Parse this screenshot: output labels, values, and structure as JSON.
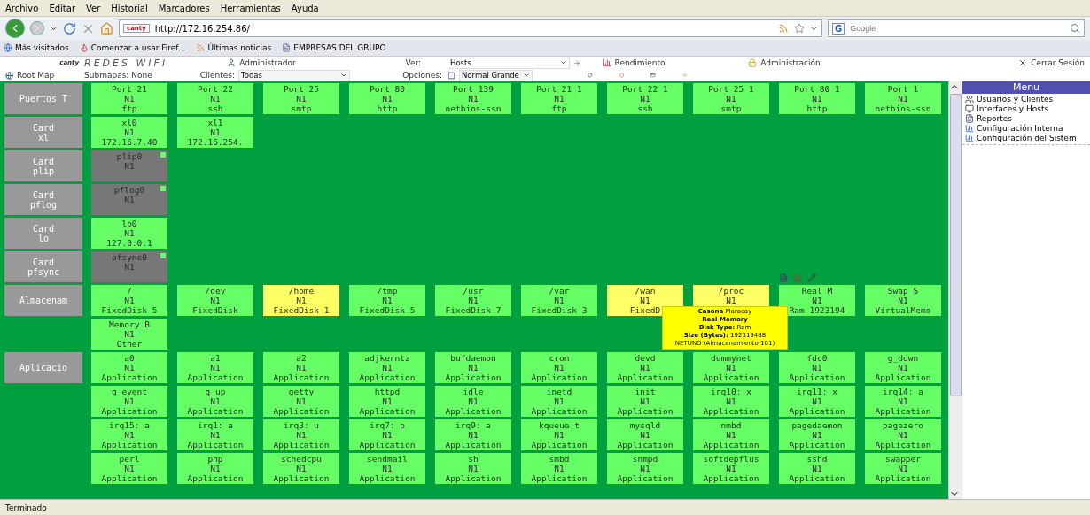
{
  "browser": {
    "menu": [
      "Archivo",
      "Editar",
      "Ver",
      "Historial",
      "Marcadores",
      "Herramientas",
      "Ayuda"
    ],
    "favicon": "canty",
    "url": "http://172.16.254.86/",
    "search": {
      "engine": "G",
      "placeholder": "Google"
    },
    "bookmarks": [
      "Más visitados",
      "Comenzar a usar Firef...",
      "Últimas noticias",
      "EMPRESAS DEL GRUPO"
    ]
  },
  "header": {
    "logo": "canty",
    "title": "REDES WIFI",
    "user": "Administrador",
    "ver_label": "Ver:",
    "ver_value": "Hosts",
    "rendimiento": "Rendimiento",
    "administracion": "Administración",
    "logout": "Cerrar Sesión",
    "root_map": "Root Map",
    "submapas": "Submapas: None",
    "clientes_label": "Clientes:",
    "clientes_value": "Todas",
    "opciones_label": "Opciones:",
    "opciones_value": "Normal Grande"
  },
  "groups": [
    {
      "label": [
        "Puertos T"
      ],
      "rows": [
        [
          {
            "lines": [
              "Port 21",
              "N1",
              "ftp"
            ],
            "color": "#66ff66",
            "indicator": false
          },
          {
            "lines": [
              "Port 22",
              "N1",
              "ssh"
            ],
            "color": "#66ff66",
            "indicator": false
          },
          {
            "lines": [
              "Port 25",
              "N1",
              "smtp"
            ],
            "color": "#66ff66",
            "indicator": false
          },
          {
            "lines": [
              "Port 80",
              "N1",
              "http"
            ],
            "color": "#66ff66",
            "indicator": false
          },
          {
            "lines": [
              "Port 139",
              "N1",
              "netbios-ssn"
            ],
            "color": "#66ff66",
            "indicator": false
          },
          {
            "lines": [
              "Port 21 1",
              "N1",
              "ftp"
            ],
            "color": "#66ff66",
            "indicator": false
          },
          {
            "lines": [
              "Port 22 1",
              "N1",
              "ssh"
            ],
            "color": "#66ff66",
            "indicator": false
          },
          {
            "lines": [
              "Port 25 1",
              "N1",
              "smtp"
            ],
            "color": "#66ff66",
            "indicator": false
          },
          {
            "lines": [
              "Port 80 1",
              "N1",
              "http"
            ],
            "color": "#66ff66",
            "indicator": false
          },
          {
            "lines": [
              "Port 1",
              "N1",
              "netbios-ssn"
            ],
            "color": "#66ff66",
            "indicator": false
          }
        ]
      ]
    },
    {
      "label": [
        "Card",
        "xl"
      ],
      "rows": [
        [
          {
            "lines": [
              "xl0",
              "N1",
              "172.16.7.40"
            ],
            "color": "#66ff66",
            "indicator": false
          },
          {
            "lines": [
              "xl1",
              "N1",
              "172.16.254."
            ],
            "color": "#66ff66",
            "indicator": false
          }
        ]
      ]
    },
    {
      "label": [
        "Card",
        "plip"
      ],
      "rows": [
        [
          {
            "lines": [
              "plip0",
              "N1"
            ],
            "color": "#777777",
            "indicator": true
          }
        ]
      ]
    },
    {
      "label": [
        "Card",
        "pflog"
      ],
      "rows": [
        [
          {
            "lines": [
              "pflog0",
              "N1"
            ],
            "color": "#777777",
            "indicator": true
          }
        ]
      ]
    },
    {
      "label": [
        "Card",
        "lo"
      ],
      "rows": [
        [
          {
            "lines": [
              "lo0",
              "N1",
              "127.0.0.1"
            ],
            "color": "#66ff66",
            "indicator": false
          }
        ]
      ]
    },
    {
      "label": [
        "Card",
        "pfsync"
      ],
      "rows": [
        [
          {
            "lines": [
              "pfsync0",
              "N1"
            ],
            "color": "#777777",
            "indicator": true
          }
        ]
      ]
    },
    {
      "label": [
        "Almacenam"
      ],
      "rows": [
        [
          {
            "lines": [
              "/",
              "N1",
              "FixedDisk 5"
            ],
            "color": "#66ff66",
            "indicator": false
          },
          {
            "lines": [
              "/dev",
              "N1",
              "FixedDisk"
            ],
            "color": "#66ff66",
            "indicator": false
          },
          {
            "lines": [
              "/home",
              "N1",
              "FixedDisk 1"
            ],
            "color": "#ffff66",
            "indicator": false
          },
          {
            "lines": [
              "/tmp",
              "N1",
              "FixedDisk 5"
            ],
            "color": "#66ff66",
            "indicator": false
          },
          {
            "lines": [
              "/usr",
              "N1",
              "FixedDisk 7"
            ],
            "color": "#66ff66",
            "indicator": false
          },
          {
            "lines": [
              "/var",
              "N1",
              "FixedDisk 3"
            ],
            "color": "#66ff66",
            "indicator": false
          },
          {
            "lines": [
              "/wan",
              "N1",
              "FixedD"
            ],
            "color": "#ffff66",
            "indicator": false,
            "tooltip": [
              "**Casona** Maracay",
              "**Real Memory**",
              "**Disk Type:** Ram",
              "**Size (Bytes):** 192319488",
              "NETUNO (Almacenamiento 101)"
            ]
          },
          {
            "lines": [
              "/proc",
              "N1"
            ],
            "color": "#ffff66",
            "indicator": false
          },
          {
            "lines": [
              "Real M",
              "N1",
              "Ram 1923194"
            ],
            "color": "#66ff66",
            "indicator": false,
            "actions": true
          },
          {
            "lines": [
              "Swap S",
              "N1",
              "VirtualMemo"
            ],
            "color": "#66ff66",
            "indicator": false
          }
        ],
        [
          {
            "lines": [
              "Memory B",
              "N1",
              "Other"
            ],
            "color": "#66ff66",
            "indicator": false
          }
        ]
      ]
    },
    {
      "label": [
        "Aplicacio"
      ],
      "rows": [
        [
          {
            "lines": [
              "a0",
              "N1",
              "Application"
            ],
            "color": "#66ff66",
            "indicator": false
          },
          {
            "lines": [
              "a1",
              "N1",
              "Application"
            ],
            "color": "#66ff66",
            "indicator": false
          },
          {
            "lines": [
              "a2",
              "N1",
              "Application"
            ],
            "color": "#66ff66",
            "indicator": false
          },
          {
            "lines": [
              "adjkerntz",
              "N1",
              "Application"
            ],
            "color": "#66ff66",
            "indicator": false
          },
          {
            "lines": [
              "bufdaemon",
              "N1",
              "Application"
            ],
            "color": "#66ff66",
            "indicator": false
          },
          {
            "lines": [
              "cron",
              "N1",
              "Application"
            ],
            "color": "#66ff66",
            "indicator": false
          },
          {
            "lines": [
              "devd",
              "N1",
              "Application"
            ],
            "color": "#66ff66",
            "indicator": false
          },
          {
            "lines": [
              "dummynet",
              "N1",
              "Application"
            ],
            "color": "#66ff66",
            "indicator": false
          },
          {
            "lines": [
              "fdc0",
              "N1",
              "Application"
            ],
            "color": "#66ff66",
            "indicator": false
          },
          {
            "lines": [
              "g_down",
              "N1",
              "Application"
            ],
            "color": "#66ff66",
            "indicator": false
          }
        ],
        [
          {
            "lines": [
              "g_event",
              "N1",
              "Application"
            ],
            "color": "#66ff66",
            "indicator": false
          },
          {
            "lines": [
              "g_up",
              "N1",
              "Application"
            ],
            "color": "#66ff66",
            "indicator": false
          },
          {
            "lines": [
              "getty",
              "N1",
              "Application"
            ],
            "color": "#66ff66",
            "indicator": false
          },
          {
            "lines": [
              "httpd",
              "N1",
              "Application"
            ],
            "color": "#66ff66",
            "indicator": false
          },
          {
            "lines": [
              "idle",
              "N1",
              "Application"
            ],
            "color": "#66ff66",
            "indicator": false
          },
          {
            "lines": [
              "inetd",
              "N1",
              "Application"
            ],
            "color": "#66ff66",
            "indicator": false
          },
          {
            "lines": [
              "init",
              "N1",
              "Application"
            ],
            "color": "#66ff66",
            "indicator": false
          },
          {
            "lines": [
              "irq10: x",
              "N1",
              "Application"
            ],
            "color": "#66ff66",
            "indicator": false
          },
          {
            "lines": [
              "irq11: x",
              "N1",
              "Application"
            ],
            "color": "#66ff66",
            "indicator": false
          },
          {
            "lines": [
              "irq14: a",
              "N1",
              "Application"
            ],
            "color": "#66ff66",
            "indicator": false
          }
        ],
        [
          {
            "lines": [
              "irq15: a",
              "N1",
              "Application"
            ],
            "color": "#66ff66",
            "indicator": false
          },
          {
            "lines": [
              "irq1: a",
              "N1",
              "Application"
            ],
            "color": "#66ff66",
            "indicator": false
          },
          {
            "lines": [
              "irq3: u",
              "N1",
              "Application"
            ],
            "color": "#66ff66",
            "indicator": false
          },
          {
            "lines": [
              "irq7: p",
              "N1",
              "Application"
            ],
            "color": "#66ff66",
            "indicator": false
          },
          {
            "lines": [
              "irq9: a",
              "N1",
              "Application"
            ],
            "color": "#66ff66",
            "indicator": false
          },
          {
            "lines": [
              "kqueue t",
              "N1",
              "Application"
            ],
            "color": "#66ff66",
            "indicator": false
          },
          {
            "lines": [
              "mysqld",
              "N1",
              "Application"
            ],
            "color": "#66ff66",
            "indicator": false
          },
          {
            "lines": [
              "nmbd",
              "N1",
              "Application"
            ],
            "color": "#66ff66",
            "indicator": false
          },
          {
            "lines": [
              "pagedaemon",
              "N1",
              "Application"
            ],
            "color": "#66ff66",
            "indicator": false
          },
          {
            "lines": [
              "pagezero",
              "N1",
              "Application"
            ],
            "color": "#66ff66",
            "indicator": false
          }
        ],
        [
          {
            "lines": [
              "perl",
              "N1",
              "Application"
            ],
            "color": "#66ff66",
            "indicator": false
          },
          {
            "lines": [
              "php",
              "N1",
              "Application"
            ],
            "color": "#66ff66",
            "indicator": false
          },
          {
            "lines": [
              "schedcpu",
              "N1",
              "Application"
            ],
            "color": "#66ff66",
            "indicator": false
          },
          {
            "lines": [
              "sendmail",
              "N1",
              "Application"
            ],
            "color": "#66ff66",
            "indicator": false
          },
          {
            "lines": [
              "sh",
              "N1",
              "Application"
            ],
            "color": "#66ff66",
            "indicator": false
          },
          {
            "lines": [
              "smbd",
              "N1",
              "Application"
            ],
            "color": "#66ff66",
            "indicator": false
          },
          {
            "lines": [
              "snmpd",
              "N1",
              "Application"
            ],
            "color": "#66ff66",
            "indicator": false
          },
          {
            "lines": [
              "softdepflus",
              "N1",
              "Application"
            ],
            "color": "#66ff66",
            "indicator": false
          },
          {
            "lines": [
              "sshd",
              "N1",
              "Application"
            ],
            "color": "#66ff66",
            "indicator": false
          },
          {
            "lines": [
              "swapper",
              "N1",
              "Application"
            ],
            "color": "#66ff66",
            "indicator": false
          }
        ]
      ]
    }
  ],
  "menu": {
    "title": "Menu",
    "items": [
      {
        "label": "Usuarios y Clientes",
        "kind": "users"
      },
      {
        "label": "Interfaces y Hosts",
        "kind": "hosts"
      },
      {
        "label": "Reportes",
        "kind": "report"
      },
      {
        "label": "Configuración Interna",
        "kind": "config"
      },
      {
        "label": "Configuración del Sistem",
        "kind": "config"
      }
    ]
  },
  "status_bar": "Terminado"
}
